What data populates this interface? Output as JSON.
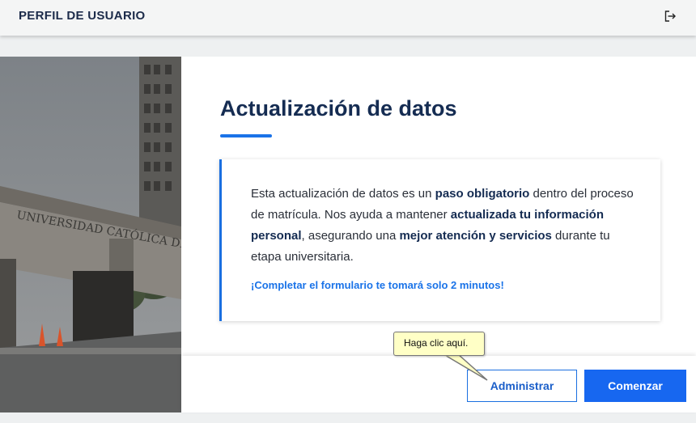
{
  "header": {
    "title": "PERFIL DE USUARIO",
    "logout_icon": "logout-icon"
  },
  "photo": {
    "sign_text": "UNIVERSIDAD CATÓLICA DE"
  },
  "main": {
    "title": "Actualización de datos",
    "card": {
      "text_1": "Esta actualización de datos es un ",
      "bold_1": "paso obligatorio",
      "text_2": " dentro del proceso de matrícula. Nos ayuda a mantener ",
      "bold_2": "actualizada tu información personal",
      "text_3": ", asegurando una ",
      "bold_3": "mejor atención y servicios",
      "text_4": " durante tu etapa universitaria.",
      "highlight": "¡Completar el formulario te tomará solo 2 minutos!"
    }
  },
  "footer": {
    "admin_label": "Administrar",
    "start_label": "Comenzar"
  },
  "tooltip": {
    "text": "Haga clic aquí."
  },
  "colors": {
    "accent": "#1767f0",
    "title": "#152c52",
    "tooltip_bg": "#ffffc6"
  }
}
